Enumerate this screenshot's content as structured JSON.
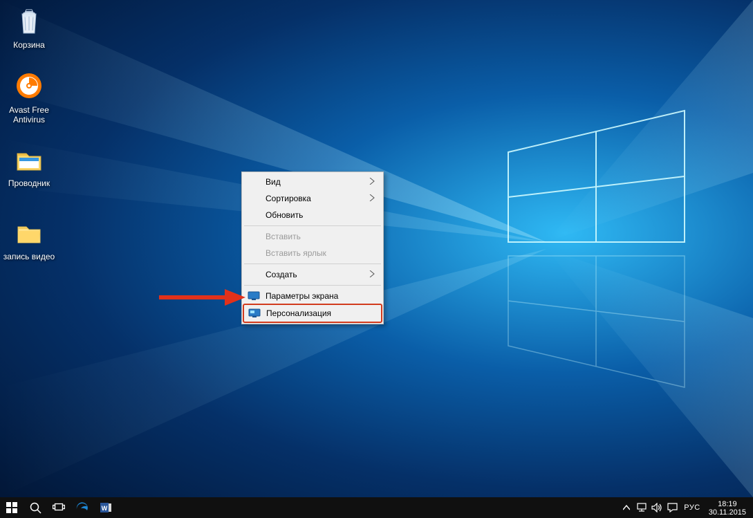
{
  "desktop_icons": [
    {
      "name": "recycle-bin",
      "label": "Корзина"
    },
    {
      "name": "avast",
      "label": "Avast Free Antivirus"
    },
    {
      "name": "explorer",
      "label": "Проводник"
    },
    {
      "name": "video-record",
      "label": "запись видео"
    }
  ],
  "context_menu": {
    "view": "Вид",
    "sort": "Сортировка",
    "refresh": "Обновить",
    "paste": "Вставить",
    "paste_shortcut": "Вставить ярлык",
    "create": "Создать",
    "display_settings": "Параметры экрана",
    "personalization": "Персонализация"
  },
  "taskbar": {
    "language": "РУС",
    "time": "18:19",
    "date": "30.11.2015"
  }
}
